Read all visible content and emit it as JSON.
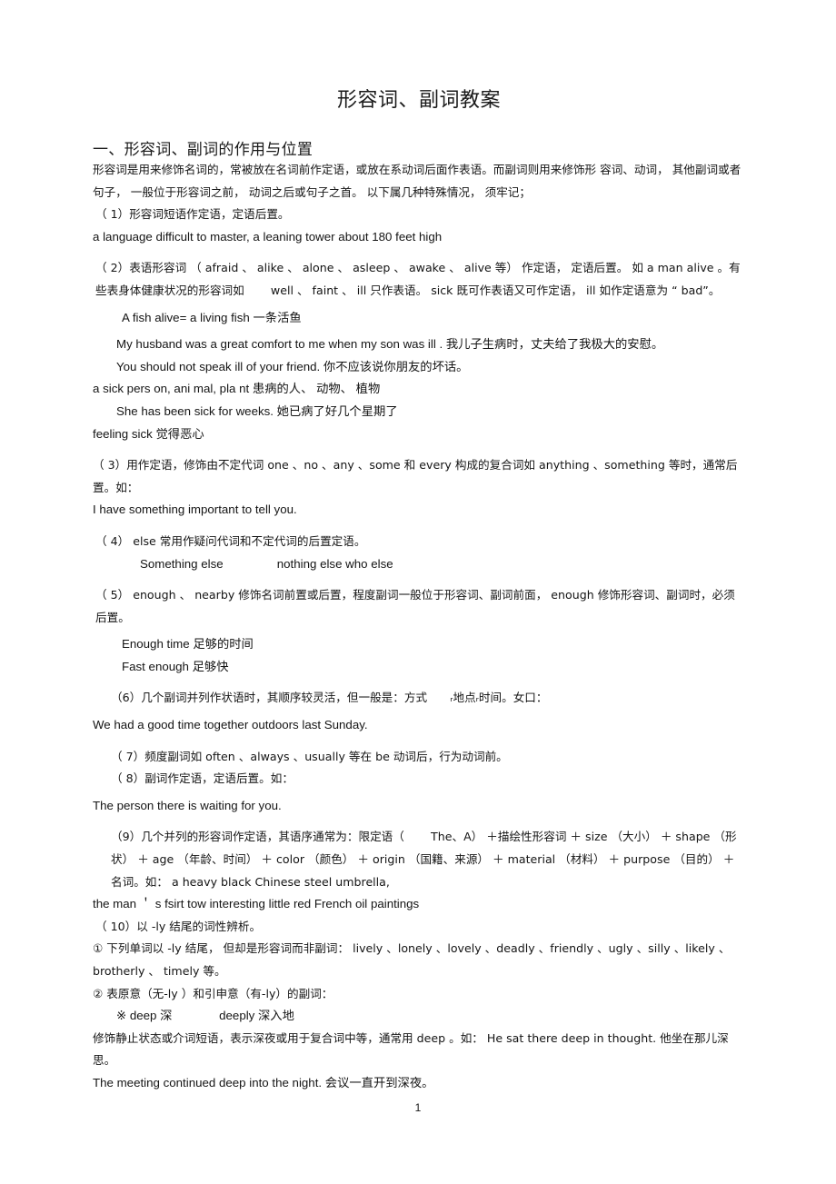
{
  "document": {
    "title": "形容词、副词教案",
    "page_number": "1"
  },
  "sections": [
    {
      "heading": "一、形容词、副词的作用与位置",
      "blocks": [
        {
          "id": "intro",
          "text": "形容词是用来修饰名词的，常被放在名词前作定语，或放在系动词后面作表语。而副词则用来修饰形 容词、动词， 其他副词或者句子， 一般位于形容词之前， 动词之后或句子之首。 以下属几种特殊情况， 须牢记；"
        },
        {
          "id": "item-1",
          "text": "（ 1）形容词短语作定语，定语后置。"
        },
        {
          "id": "item-1-example",
          "text": "a language difficult to master, a leaning tower about 180 feet high"
        },
        {
          "id": "item-2",
          "text": "（ 2）表语形容词 （ afraid 、 alike 、 alone 、 asleep 、 awake 、 alive 等） 作定语， 定语后置。 如 a man alive 。有些表身体健康状况的形容词如　　 well 、 faint 、 ill 只作表语。 sick 既可作表语又可作定语， ill 如作定语意为 “ bad”。"
        },
        {
          "id": "item-2-example-1",
          "text": "A fish alive= a living fish 一条活鱼"
        },
        {
          "id": "item-2-example-2",
          "text": "My husband was a great comfort to me when my son was ill . 我儿子生病时，丈夫给了我极大的安慰。"
        },
        {
          "id": "item-2-example-3",
          "text": "You should not speak ill of your friend. 你不应该说你朋友的坏话。"
        },
        {
          "id": "item-2-example-4",
          "text": "a sick pers on, ani mal, pla nt 患病的人、 动物、 植物"
        },
        {
          "id": "item-2-example-5",
          "text": "She has been sick for weeks. 她已病了好几个星期了"
        },
        {
          "id": "item-2-example-6",
          "text": "feeling sick 觉得恶心"
        },
        {
          "id": "item-3",
          "text": "（ 3）用作定语，修饰由不定代词 one 、no 、any 、some 和 every 构成的复合词如 anything 、something 等时，通常后置。如："
        },
        {
          "id": "item-3-example",
          "text": "I have something important to tell you."
        },
        {
          "id": "item-4",
          "text": "（ 4） else 常用作疑问代词和不定代词的后置定语。"
        },
        {
          "id": "item-4-example",
          "text": "Something else                nothing else who else"
        },
        {
          "id": "item-5",
          "text": "（ 5） enough 、 nearby 修饰名词前置或后置，程度副词一般位于形容词、副词前面， enough 修饰形容词、副词时，必须后置。"
        },
        {
          "id": "item-5-example-1",
          "text": "Enough time 足够的时间"
        },
        {
          "id": "item-5-example-2",
          "text": "Fast enough 足够快"
        },
        {
          "id": "item-6",
          "text": "（6）几个副词并列作状语时，其顺序较灵活，但一般是：方式　　ᵣ地点ᵣ时间。女口："
        },
        {
          "id": "item-6-example",
          "text": "We had a good time together outdoors last Sunday."
        },
        {
          "id": "item-7",
          "text": "（ 7）频度副词如 often 、always 、usually 等在 be 动词后，行为动词前。"
        },
        {
          "id": "item-8",
          "text": "（ 8）副词作定语，定语后置。如："
        },
        {
          "id": "item-8-example",
          "text": "The person there is waiting for you."
        },
        {
          "id": "item-9",
          "text": "（9）几个并列的形容词作定语，其语序通常为：限定语（　　 The、A） ＋描绘性形容词 ＋ size （大小） ＋ shape （形状） ＋ age （年龄、时间） ＋ color （颜色） ＋ origin （国籍、来源） ＋ material （材料） ＋ purpose （目的） ＋ 名词。如： a heavy black Chinese steel umbrella,"
        },
        {
          "id": "item-9-example",
          "text": "the man ＇ s fsirt tow interesting little red French oil paintings"
        },
        {
          "id": "item-10",
          "text": "（ 10）以 -ly 结尾的词性辨析。"
        },
        {
          "id": "item-10-sub-1",
          "text": "① 下列单词以 -ly 结尾， 但却是形容词而非副词： lively 、lonely 、lovely 、deadly 、friendly 、ugly 、silly 、likely 、brotherly 、 timely 等。"
        },
        {
          "id": "item-10-sub-2",
          "text": "② 表原意（无-ly ）和引申意（有-ly）的副词："
        },
        {
          "id": "item-10-deep-pair",
          "text": "※ deep 深              deeply 深入地"
        },
        {
          "id": "item-10-deep-note",
          "text": "修饰静止状态或介词短语，表示深夜或用于复合词中等，通常用 deep 。如： He sat there deep in thought. 他坐在那儿深思。"
        },
        {
          "id": "item-10-deep-example",
          "text": "The meeting continued deep into the night. 会议一直开到深夜。"
        }
      ]
    }
  ]
}
